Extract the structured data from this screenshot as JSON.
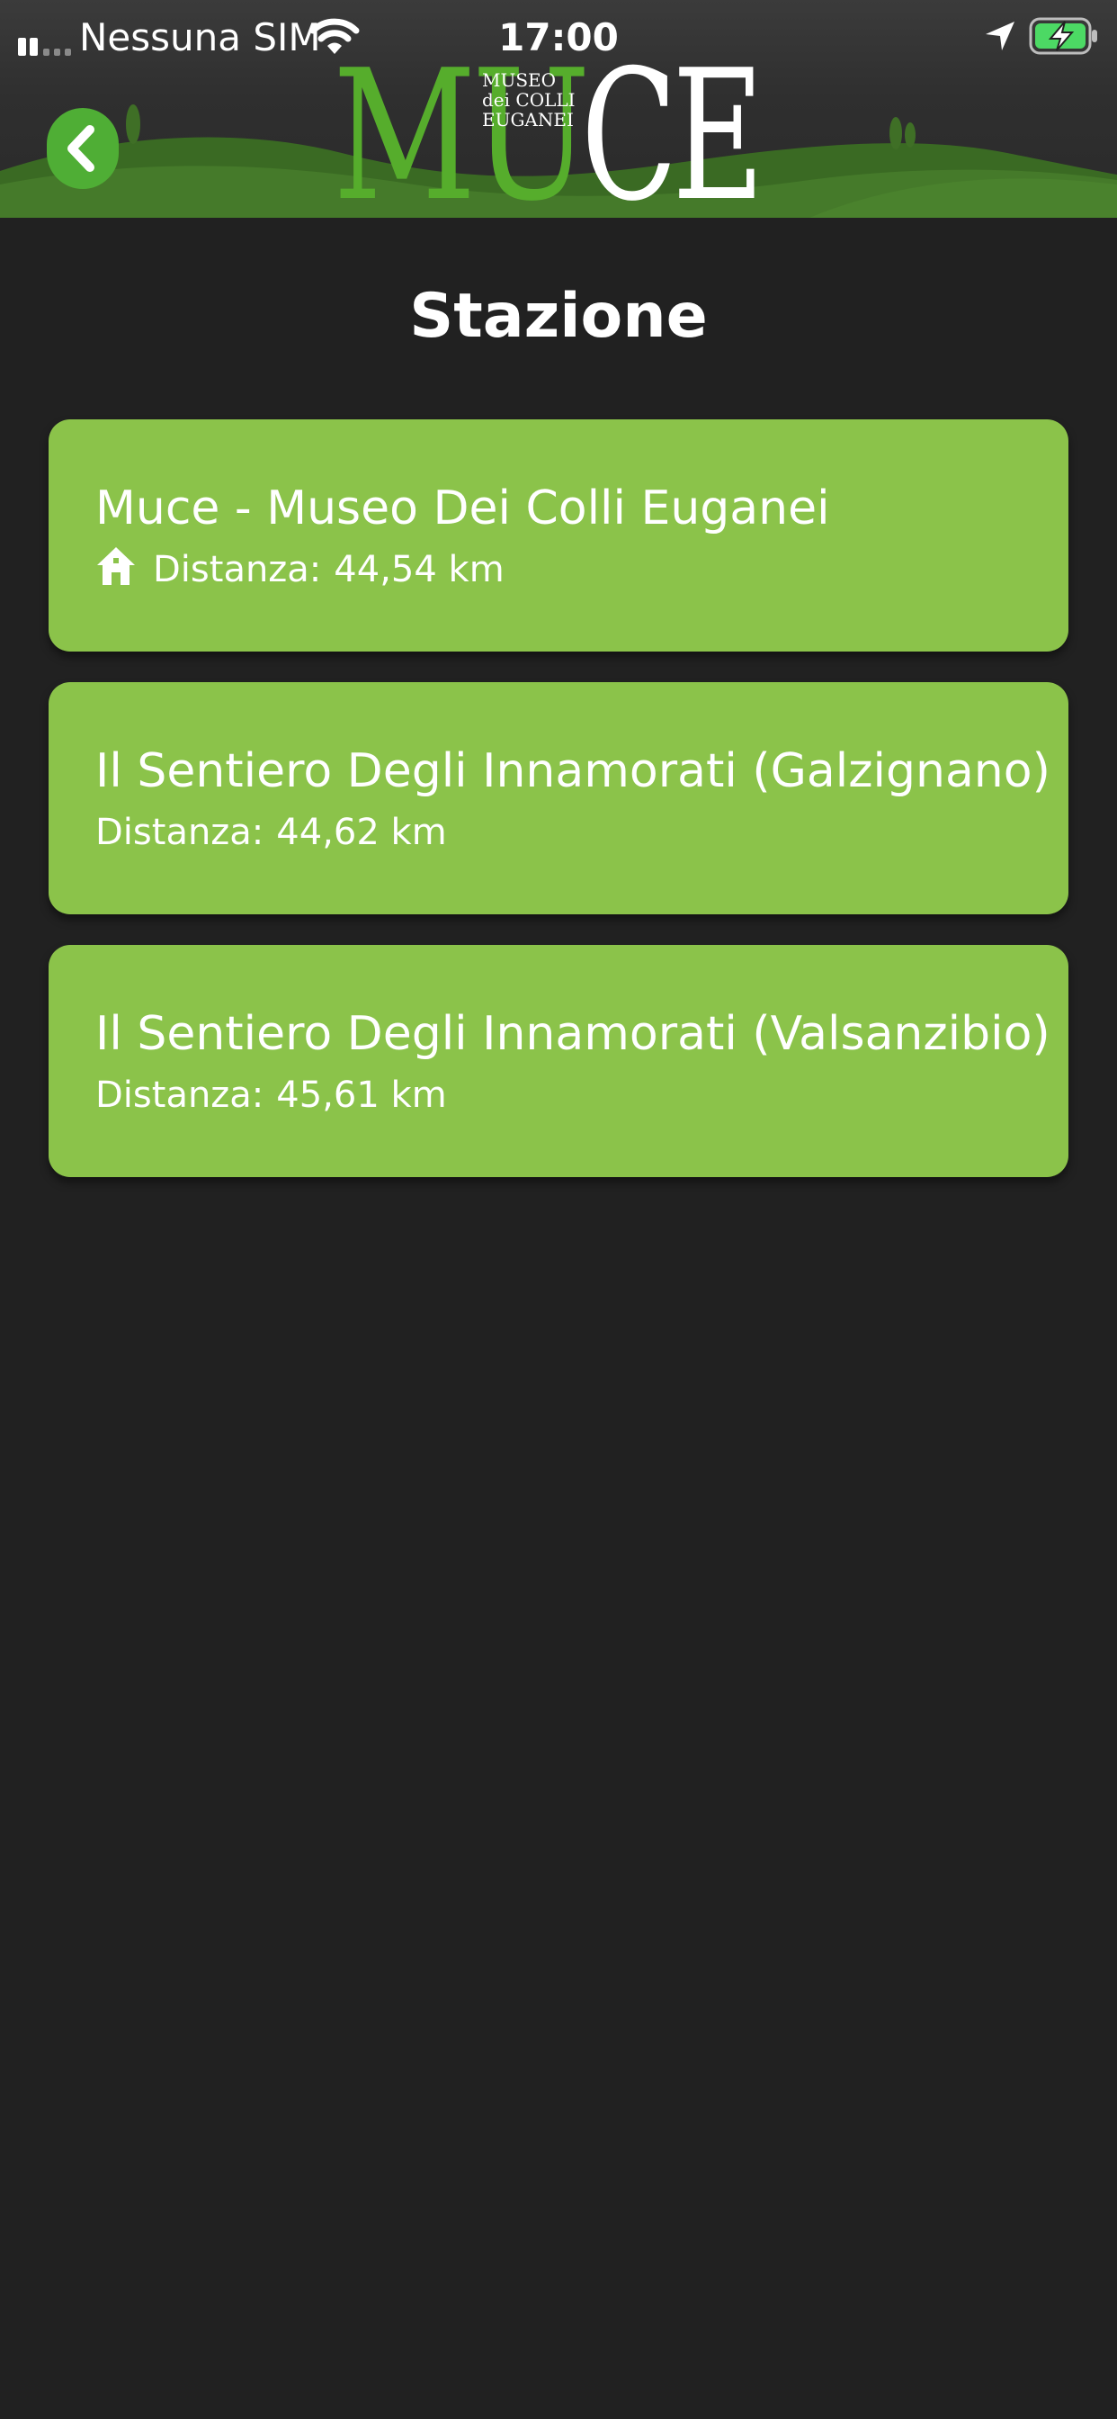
{
  "status_bar": {
    "carrier": "Nessuna SIM",
    "time": "17:00"
  },
  "header": {
    "logo": {
      "left": "MU",
      "right": "CE",
      "sub_lines": [
        "MUSEO",
        "dei COLLI",
        "EUGANEI"
      ]
    }
  },
  "page": {
    "title": "Stazione"
  },
  "stations": [
    {
      "name": "Muce - Museo Dei Colli Euganei",
      "distance_label": "Distanza:",
      "distance": "44,54 km",
      "icon": "home-icon"
    },
    {
      "name": "Il Sentiero Degli Innamorati (Galzignano)",
      "distance_label": "Distanza:",
      "distance": "44,62 km"
    },
    {
      "name": "Il Sentiero Degli Innamorati (Valsanzibio)",
      "distance_label": "Distanza:",
      "distance": "45,61 km"
    }
  ],
  "colors": {
    "background": "#212121",
    "card": "#8bc34a",
    "accent": "#4fae35",
    "hills": "#3f6f26"
  }
}
